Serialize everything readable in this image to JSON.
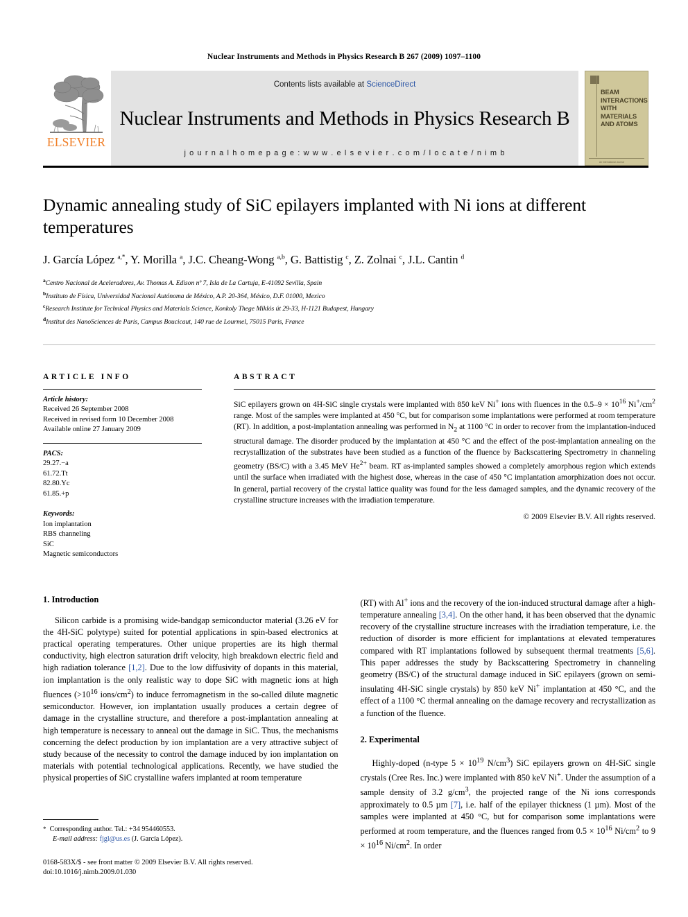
{
  "running_head": "Nuclear Instruments and Methods in Physics Research B 267 (2009) 1097–1100",
  "masthead": {
    "contents_prefix": "Contents lists available at ",
    "sciencedirect": "ScienceDirect",
    "journal_title": "Nuclear Instruments and Methods in Physics Research B",
    "homepage": "j o u r n a l   h o m e p a g e :   w w w . e l s e v i e r . c o m / l o c a t e / n i m b",
    "publisher": "ELSEVIER",
    "cover_words": "BEAM\nINTERACTIONS\nWITH\nMATERIALS\nAND ATOMS",
    "cover_footer": "An International Journal"
  },
  "article": {
    "title": "Dynamic annealing study of SiC epilayers implanted with Ni ions at different temperatures",
    "authors_html": "J. García López <sup>a,*</sup>, Y. Morilla <sup>a</sup>, J.C. Cheang-Wong <sup>a,b</sup>, G. Battistig <sup>c</sup>, Z. Zolnai <sup>c</sup>, J.L. Cantin <sup>d</sup>",
    "affiliations": [
      {
        "mark": "a",
        "text": "Centro Nacional de Aceleradores, Av. Thomas A. Edison nº 7, Isla de La Cartuja, E-41092 Sevilla, Spain"
      },
      {
        "mark": "b",
        "text": "Instituto de Física, Universidad Nacional Autónoma de México, A.P. 20-364, México, D.F. 01000, Mexico"
      },
      {
        "mark": "c",
        "text": "Research Institute for Technical Physics and Materials Science, Konkoly Thege Miklós út 29-33, H-1121 Budapest, Hungary"
      },
      {
        "mark": "d",
        "text": "Institut des NanoSciences de Paris, Campus Boucicaut, 140 rue de Lourmel, 75015 Paris, France"
      }
    ]
  },
  "article_info": {
    "heading": "ARTICLE INFO",
    "history_label": "Article history:",
    "history": [
      "Received 26 September 2008",
      "Received in revised form 10 December 2008",
      "Available online 27 January 2009"
    ],
    "pacs_label": "PACS:",
    "pacs": [
      "29.27.−a",
      "61.72.Tt",
      "82.80.Yc",
      "61.85.+p"
    ],
    "keywords_label": "Keywords:",
    "keywords": [
      "Ion implantation",
      "RBS channeling",
      "SiC",
      "Magnetic semiconductors"
    ]
  },
  "abstract": {
    "heading": "ABSTRACT",
    "body_html": "SiC epilayers grown on 4H-SiC single crystals were implanted with 850 keV Ni<sup>+</sup> ions with fluences in the 0.5–9 &#215; 10<sup>16</sup> Ni<sup>+</sup>/cm<sup>2</sup> range. Most of the samples were implanted at 450 °C, but for comparison some implantations were performed at room temperature (RT). In addition, a post-implantation annealing was performed in N<sub>2</sub> at 1100 °C in order to recover from the implantation-induced structural damage. The disorder produced by the implantation at 450 °C and the effect of the post-implantation annealing on the recrystallization of the substrates have been studied as a function of the fluence by Backscattering Spectrometry in channeling geometry (BS/C) with a 3.45 MeV He<sup>2+</sup> beam. RT as-implanted samples showed a completely amorphous region which extends until the surface when irradiated with the highest dose, whereas in the case of 450 °C implantation amorphization does not occur. In general, partial recovery of the crystal lattice quality was found for the less damaged samples, and the dynamic recovery of the crystalline structure increases with the irradiation temperature.",
    "copyright": "© 2009 Elsevier B.V. All rights reserved."
  },
  "sections": {
    "introduction_heading": "1. Introduction",
    "introduction_left_html": "Silicon carbide is a promising wide-bandgap semiconductor material (3.26 eV for the 4H-SiC polytype) suited for potential applications in spin-based electronics at practical operating temperatures. Other unique properties are its high thermal conductivity, high electron saturation drift velocity, high breakdown electric field and high radiation tolerance <span class=\"ref\">[1,2]</span>. Due to the low diffusivity of dopants in this material, ion implantation is the only realistic way to dope SiC with magnetic ions at high fluences (&gt;10<sup>16</sup> ions/cm<sup>2</sup>) to induce ferromagnetism in the so-called dilute magnetic semiconductor. However, ion implantation usually produces a certain degree of damage in the crystalline structure, and therefore a post-implantation annealing at high temperature is necessary to anneal out the damage in SiC. Thus, the mechanisms concerning the defect production by ion implantation are a very attractive subject of study because of the necessity to control the damage induced by ion implantation on materials with potential technological applications. Recently, we have studied the physical properties of SiC crystalline wafers implanted at room temperature",
    "introduction_right_html": "(RT) with Al<sup>+</sup> ions and the recovery of the ion-induced structural damage after a high-temperature annealing <span class=\"ref\">[3,4]</span>. On the other hand, it has been observed that the dynamic recovery of the crystalline structure increases with the irradiation temperature, i.e. the reduction of disorder is more efficient for implantations at elevated temperatures compared with RT implantations followed by subsequent thermal treatments <span class=\"ref\">[5,6]</span>. This paper addresses the study by Backscattering Spectrometry in channeling geometry (BS/C) of the structural damage induced in SiC epilayers (grown on semi-insulating 4H-SiC single crystals) by 850 keV Ni<sup>+</sup> implantation at 450 °C, and the effect of a 1100 °C thermal annealing on the damage recovery and recrystallization as a function of the fluence.",
    "experimental_heading": "2. Experimental",
    "experimental_html": "Highly-doped (n-type 5 &#215; 10<sup>19</sup> N/cm<sup>3</sup>) SiC epilayers grown on 4H-SiC single crystals (Cree Res. Inc.) were implanted with 850 keV Ni<sup>+</sup>. Under the assumption of a sample density of 3.2 g/cm<sup>3</sup>, the projected range of the Ni ions corresponds approximately to 0.5 µm <span class=\"ref\">[7]</span>, i.e. half of the epilayer thickness (1 µm). Most of the samples were implanted at 450 °C, but for comparison some implantations were performed at room temperature, and the fluences ranged from 0.5 &#215; 10<sup>16</sup> Ni/cm<sup>2</sup> to 9 &#215; 10<sup>16</sup> Ni/cm<sup>2</sup>. In order"
  },
  "footer": {
    "corresponding_html": "<span class=\"star\">*</span> &nbsp;Corresponding author. Tel.: +34 954460553.",
    "email_label": "E-mail address:",
    "email": "fjgl@us.es",
    "email_owner": "(J. García López).",
    "issn_line": "0168-583X/$ - see front matter © 2009 Elsevier B.V. All rights reserved.",
    "doi_line": "doi:10.1016/j.nimb.2009.01.030"
  },
  "colors": {
    "link": "#2b55a5",
    "elsevier_orange": "#f07e26",
    "masthead_bg": "#e3e3e3",
    "cover_bg": "#cfc79a"
  }
}
